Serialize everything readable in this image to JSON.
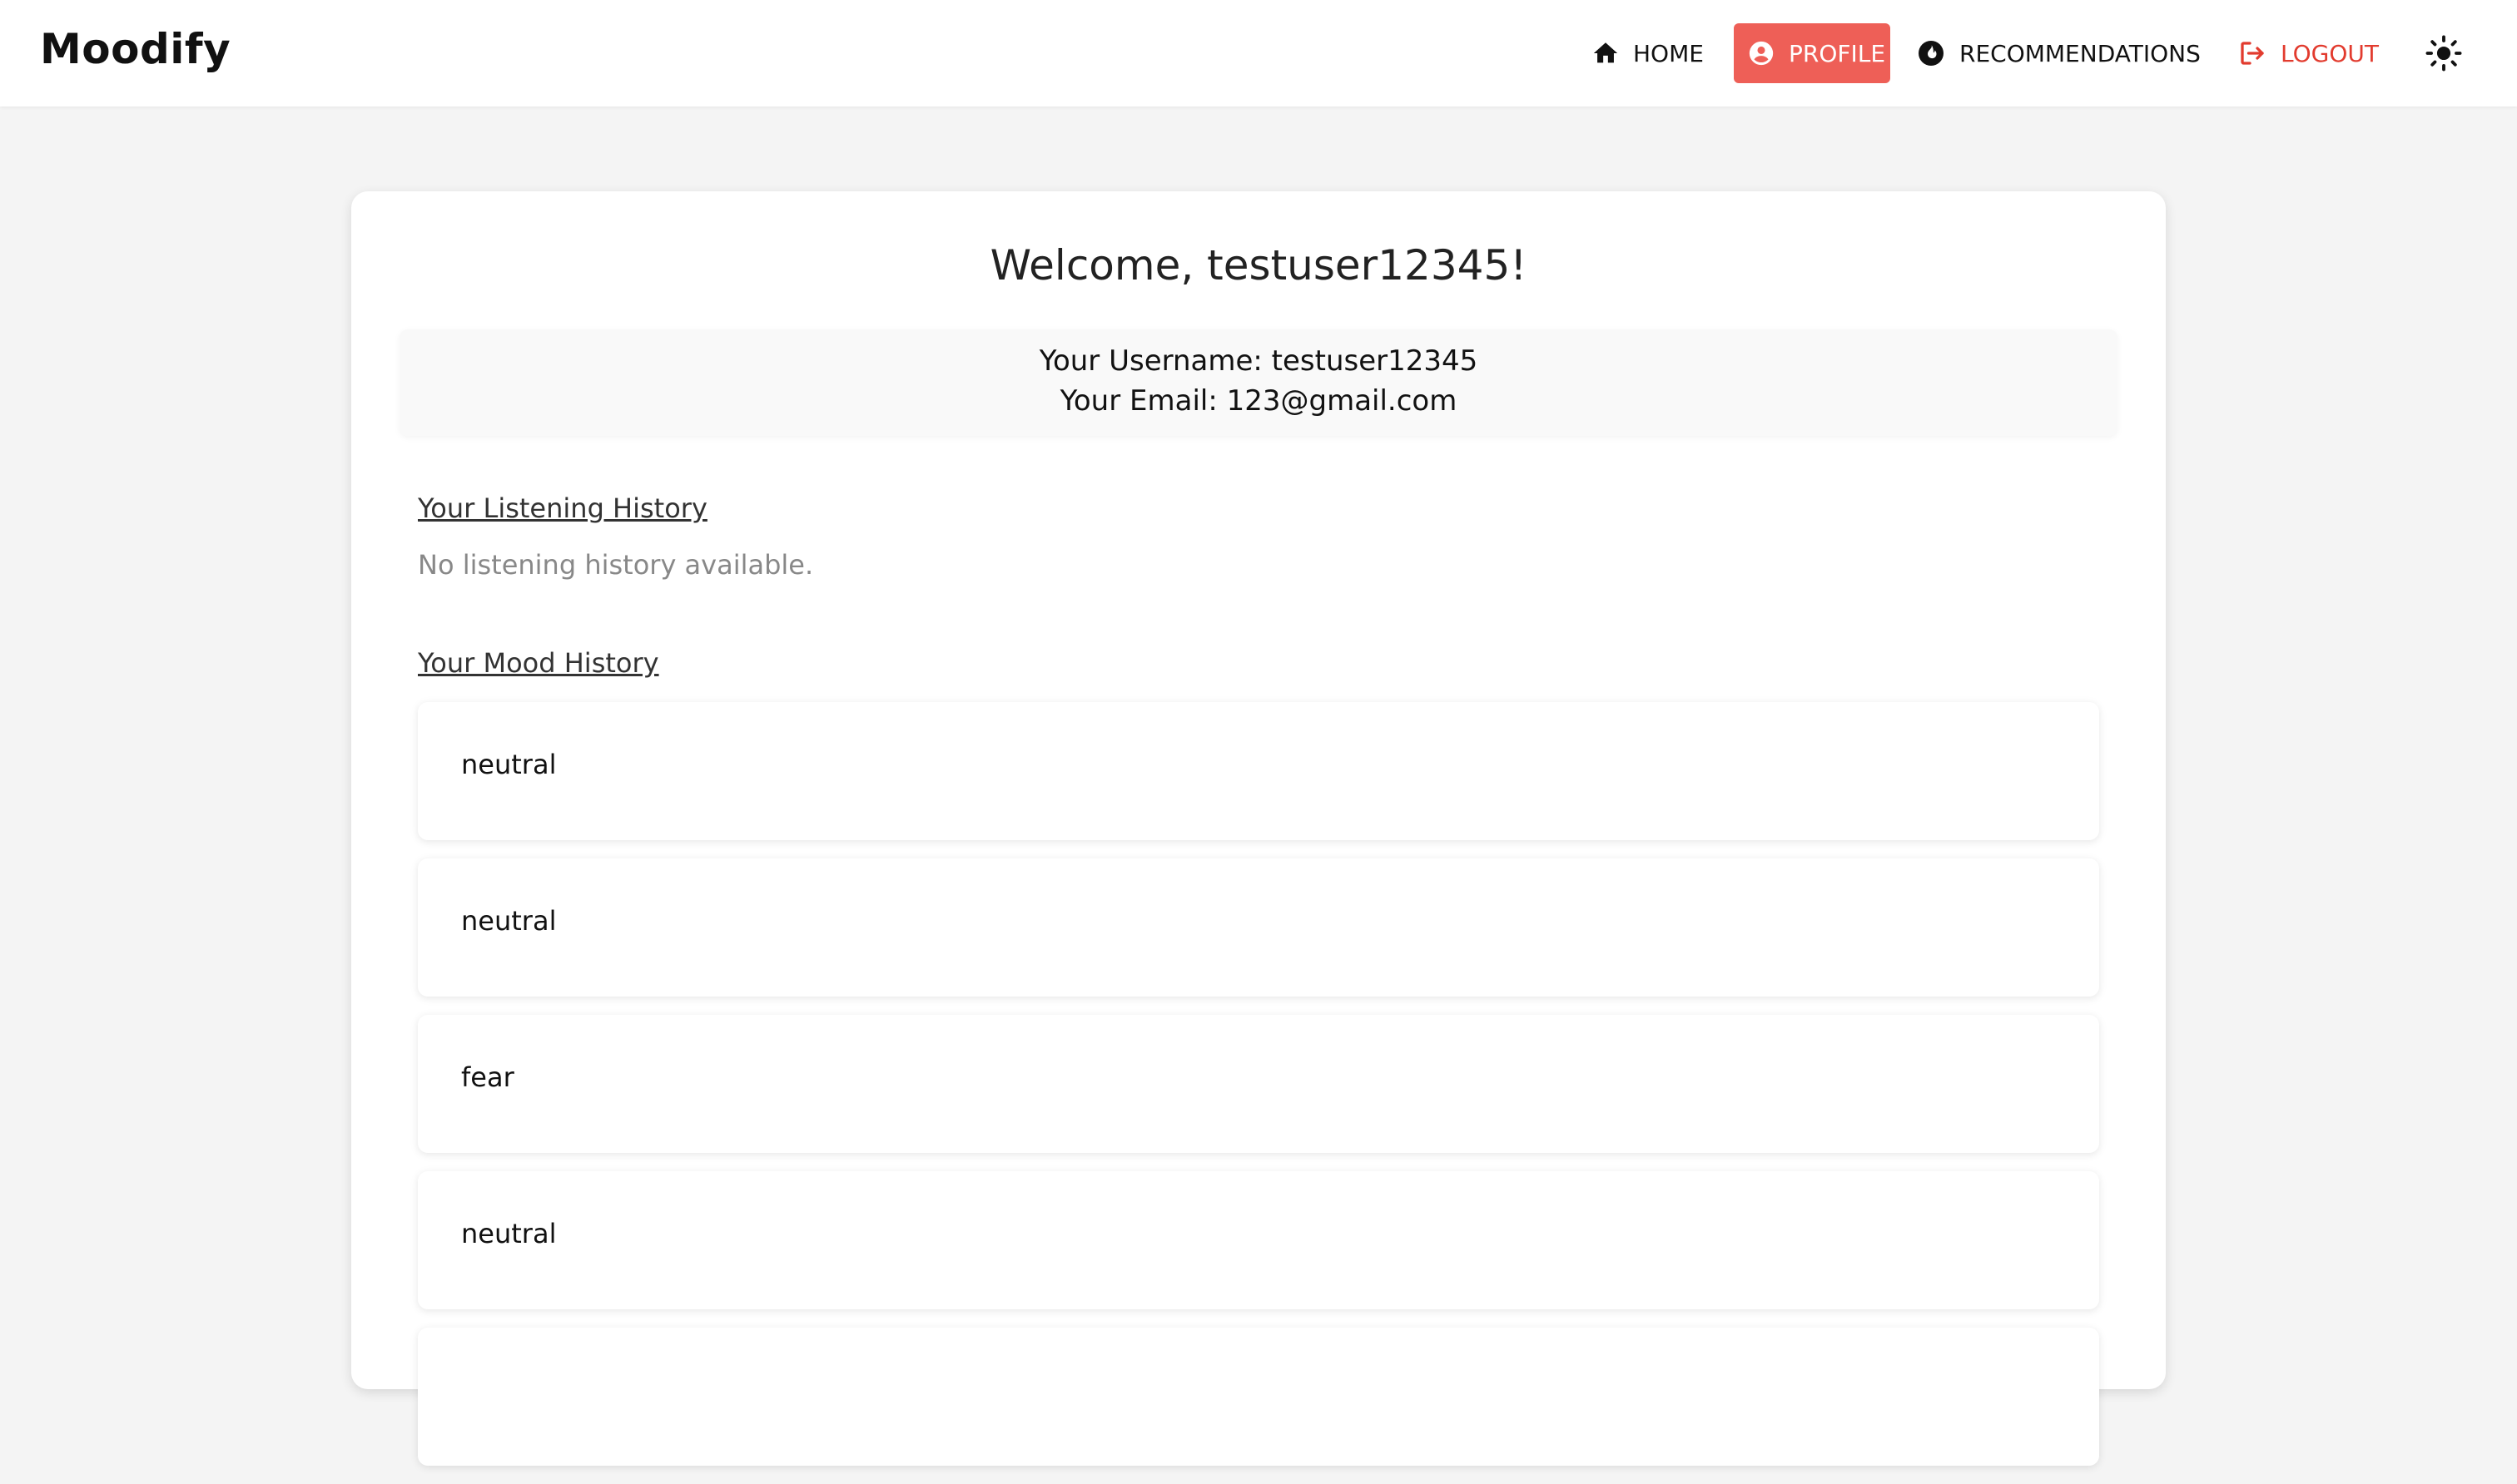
{
  "navbar": {
    "brand": "Moodify",
    "items": {
      "home": {
        "label": "HOME",
        "icon": "home-icon"
      },
      "profile": {
        "label": "PROFILE",
        "icon": "account-circle-icon",
        "active": true
      },
      "recommendations": {
        "label": "RECOMMENDATIONS",
        "icon": "whatshot-icon"
      },
      "logout": {
        "label": "LOGOUT",
        "icon": "logout-icon"
      }
    },
    "theme_toggle_icon": "sun-icon"
  },
  "profile": {
    "welcome": "Welcome, testuser12345!",
    "username_line": "Your Username: testuser12345",
    "email_line": "Your Email: 123@gmail.com"
  },
  "listening_history": {
    "title": "Your Listening History",
    "empty_message": "No listening history available."
  },
  "mood_history": {
    "title": "Your Mood History",
    "items": [
      "neutral",
      "neutral",
      "fear",
      "neutral",
      ""
    ]
  },
  "colors": {
    "accent": "#ee5f57",
    "logout": "#e23b2e",
    "page_background": "#f4f4f4"
  }
}
